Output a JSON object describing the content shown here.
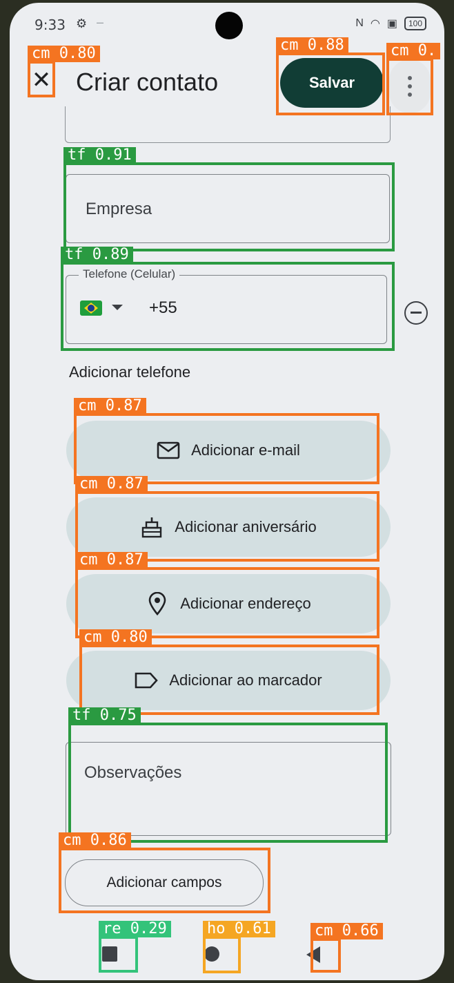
{
  "status_bar": {
    "time": "9:33",
    "settings_icon": "settings-gear-icon",
    "dash": "–",
    "battery": "100"
  },
  "app_bar": {
    "close_icon": "close-icon",
    "title": "Criar contato",
    "save_label": "Salvar",
    "more_icon": "more-vert-icon"
  },
  "fields": {
    "company_placeholder": "Empresa",
    "phone_label": "Telefone (Celular)",
    "phone_country": "brazil-flag-icon",
    "phone_value": "+55",
    "remove_icon": "remove-circle-icon",
    "notes_placeholder": "Observações"
  },
  "add_phone_label": "Adicionar telefone",
  "actions": [
    {
      "label": "Adicionar e-mail",
      "icon": "email-icon"
    },
    {
      "label": "Adicionar aniversário",
      "icon": "cake-icon"
    },
    {
      "label": "Adicionar endereço",
      "icon": "location-pin-icon"
    },
    {
      "label": "Adicionar ao marcador",
      "icon": "label-tag-icon"
    }
  ],
  "add_fields_label": "Adicionar campos",
  "nav": {
    "recents_icon": "recents-square-icon",
    "home_icon": "home-circle-icon",
    "back_icon": "back-triangle-icon"
  },
  "detections": [
    {
      "label": "cm 0.80",
      "class": "cm",
      "score": 0.8
    },
    {
      "label": "cm 0.88",
      "class": "cm",
      "score": 0.88
    },
    {
      "label": "cm 0.",
      "class": "cm",
      "score": null
    },
    {
      "label": "tf 0.91",
      "class": "tf",
      "score": 0.91
    },
    {
      "label": "tf 0.89",
      "class": "tf",
      "score": 0.89
    },
    {
      "label": "cm 0.87",
      "class": "cm",
      "score": 0.87
    },
    {
      "label": "cm 0.87",
      "class": "cm",
      "score": 0.87
    },
    {
      "label": "cm 0.87",
      "class": "cm",
      "score": 0.87
    },
    {
      "label": "cm 0.80",
      "class": "cm",
      "score": 0.8
    },
    {
      "label": "tf 0.75",
      "class": "tf",
      "score": 0.75
    },
    {
      "label": "cm 0.86",
      "class": "cm",
      "score": 0.86
    },
    {
      "label": "re 0.29",
      "class": "re",
      "score": 0.29
    },
    {
      "label": "ho 0.61",
      "class": "ho",
      "score": 0.61
    },
    {
      "label": "cm 0.66",
      "class": "cm",
      "score": 0.66
    }
  ],
  "colors": {
    "save_bg": "#113d35",
    "pill_bg": "#d3dfe1",
    "screen_bg": "#eceef1",
    "cm": "#f47421",
    "tf": "#2a9a41",
    "re": "#33c37a",
    "ho": "#f5a623"
  }
}
